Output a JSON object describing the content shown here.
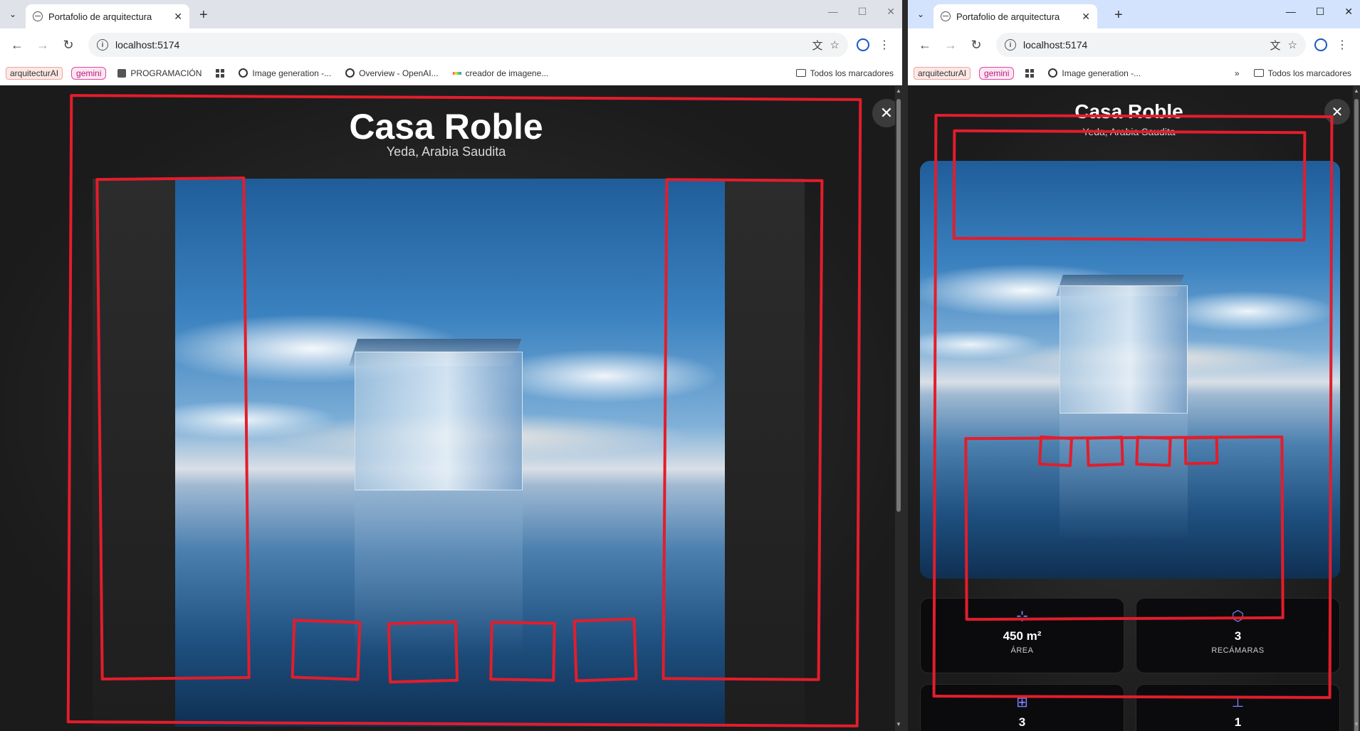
{
  "browser": {
    "tab_title": "Portafolio de arquitectura",
    "url": "localhost:5174",
    "bookmarks": [
      "arquitecturAI",
      "gemini",
      "PROGRAMACIÓN",
      "Image generation -...",
      "Overview - OpenAI...",
      "creador de imagene..."
    ],
    "bookmarks_right": [
      "arquitecturAI",
      "gemini",
      "Image generation -..."
    ],
    "all_bookmarks": "Todos los marcadores"
  },
  "project": {
    "title": "Casa Roble",
    "location": "Yeda, Arabia Saudita"
  },
  "stats": [
    {
      "icon": "area-icon",
      "value": "450 m²",
      "label": "ÁREA"
    },
    {
      "icon": "cube-icon",
      "value": "3",
      "label": "RECÁMARAS"
    },
    {
      "icon": "bath-icon",
      "value": "3",
      "label": ""
    },
    {
      "icon": "floor-icon",
      "value": "1",
      "label": ""
    }
  ],
  "colors": {
    "annotation": "#e31d2b",
    "accent": "#7d86ff"
  }
}
